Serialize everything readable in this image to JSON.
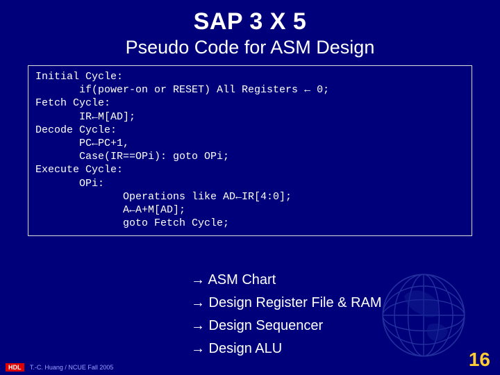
{
  "title": "SAP 3 X 5",
  "subtitle": "Pseudo Code for ASM Design",
  "code": {
    "l1": "Initial Cycle:",
    "l2": "       if(power-on or RESET) All Registers ← 0;",
    "l3": "Fetch Cycle:",
    "l4": "       IR←M[AD];",
    "l5": "Decode Cycle:",
    "l6": "       PC←PC+1,",
    "l7": "       Case(IR==OPi): goto OPi;",
    "l8": "Execute Cycle:",
    "l9": "       OPi:",
    "l10": "              Operations like AD←IR[4:0];",
    "l11": "              A←A+M[AD];",
    "l12": "              goto Fetch Cycle;"
  },
  "bullets": {
    "b1": "→ ASM Chart",
    "b2": "→ Design Register File & RAM",
    "b3": "→ Design Sequencer",
    "b4": "→ Design ALU"
  },
  "footer": {
    "hdl": "HDL",
    "credit": "T.-C. Huang / NCUE  Fall 2005"
  },
  "pagenum": "16"
}
